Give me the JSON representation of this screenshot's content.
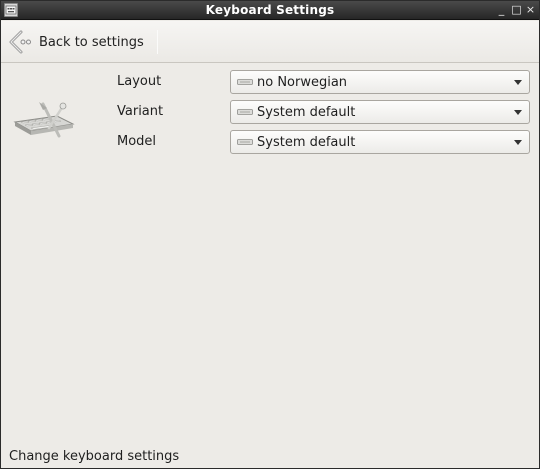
{
  "window": {
    "title": "Keyboard Settings",
    "controls": {
      "minimize": "_",
      "maximize": "□",
      "close": "×"
    }
  },
  "toolbar": {
    "back_label": "Back to settings",
    "back_icon": "back-arrow-icon"
  },
  "settings": {
    "icon": "keyboard-settings-icon",
    "rows": [
      {
        "label": "Layout",
        "value": "no Norwegian"
      },
      {
        "label": "Variant",
        "value": "System default"
      },
      {
        "label": "Model",
        "value": "System default"
      }
    ]
  },
  "status": {
    "text": "Change keyboard settings"
  },
  "colors": {
    "titlebar": "#333333",
    "background": "#edebe7",
    "combo_border": "#a9a6a0"
  }
}
